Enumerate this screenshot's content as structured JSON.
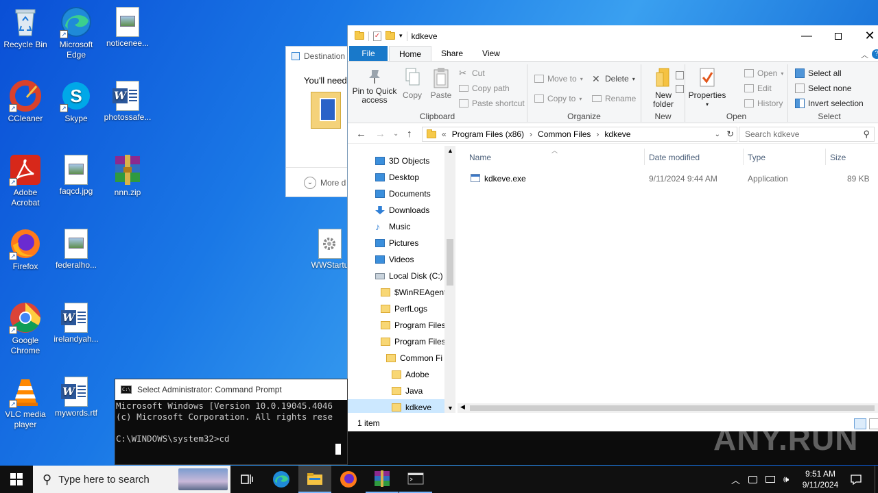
{
  "desktop": {
    "icons": [
      {
        "label": "Recycle Bin"
      },
      {
        "label": "Microsoft Edge"
      },
      {
        "label": "noticenee..."
      },
      {
        "label": "CCleaner"
      },
      {
        "label": "Skype"
      },
      {
        "label": "photossafe..."
      },
      {
        "label": "Adobe Acrobat"
      },
      {
        "label": "faqcd.jpg"
      },
      {
        "label": "nnn.zip"
      },
      {
        "label": "Firefox"
      },
      {
        "label": "federalho..."
      },
      {
        "label": "WWStartu"
      },
      {
        "label": "Google Chrome"
      },
      {
        "label": "irelandyah..."
      },
      {
        "label": "VLC media player"
      },
      {
        "label": "mywords.rtf"
      }
    ]
  },
  "destination_dialog": {
    "title": "Destination",
    "text": "You'll need t",
    "more": "More d"
  },
  "explorer": {
    "title": "kdkeve",
    "tabs": {
      "file": "File",
      "home": "Home",
      "share": "Share",
      "view": "View"
    },
    "ribbon": {
      "clipboard": {
        "pin": "Pin to Quick access",
        "copy": "Copy",
        "paste": "Paste",
        "cut": "Cut",
        "copy_path": "Copy path",
        "paste_shortcut": "Paste shortcut",
        "label": "Clipboard"
      },
      "organize": {
        "move_to": "Move to",
        "copy_to": "Copy to",
        "delete": "Delete",
        "rename": "Rename",
        "label": "Organize"
      },
      "new": {
        "new_folder": "New folder",
        "label": "New"
      },
      "open": {
        "properties": "Properties",
        "open": "Open",
        "edit": "Edit",
        "history": "History",
        "label": "Open"
      },
      "select": {
        "select_all": "Select all",
        "select_none": "Select none",
        "invert": "Invert selection",
        "label": "Select"
      }
    },
    "address": {
      "overflow": "«",
      "crumbs": [
        "Program Files (x86)",
        "Common Files",
        "kdkeve"
      ],
      "search_placeholder": "Search kdkeve"
    },
    "nav": [
      {
        "label": "3D Objects",
        "icon": "3d-objects-icon"
      },
      {
        "label": "Desktop",
        "icon": "desktop-icon"
      },
      {
        "label": "Documents",
        "icon": "documents-icon"
      },
      {
        "label": "Downloads",
        "icon": "downloads-icon"
      },
      {
        "label": "Music",
        "icon": "music-icon"
      },
      {
        "label": "Pictures",
        "icon": "pictures-icon"
      },
      {
        "label": "Videos",
        "icon": "videos-icon"
      },
      {
        "label": "Local Disk (C:)",
        "icon": "drive-icon"
      },
      {
        "label": "$WinREAgent",
        "icon": "folder-icon"
      },
      {
        "label": "PerfLogs",
        "icon": "folder-icon"
      },
      {
        "label": "Program Files",
        "icon": "folder-icon"
      },
      {
        "label": "Program Files",
        "icon": "folder-icon"
      },
      {
        "label": "Common Fi",
        "icon": "folder-icon"
      },
      {
        "label": "Adobe",
        "icon": "folder-icon"
      },
      {
        "label": "Java",
        "icon": "folder-icon"
      },
      {
        "label": "kdkeve",
        "icon": "folder-icon"
      }
    ],
    "columns": {
      "name": "Name",
      "date": "Date modified",
      "type": "Type",
      "size": "Size"
    },
    "files": [
      {
        "name": "kdkeve.exe",
        "date": "9/11/2024 9:44 AM",
        "type": "Application",
        "size": "89 KB"
      }
    ],
    "status": "1 item"
  },
  "cmd": {
    "title": "Select Administrator: Command Prompt",
    "lines": "Microsoft Windows [Version 10.0.19045.4046\n(c) Microsoft Corporation. All rights rese\n\nC:\\WINDOWS\\system32>cd"
  },
  "taskbar": {
    "search_placeholder": "Type here to search",
    "time": "9:51 AM",
    "date": "9/11/2024"
  },
  "watermark": "ANY.RUN"
}
